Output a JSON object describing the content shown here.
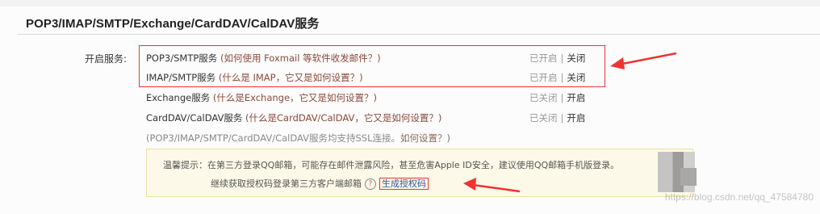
{
  "title": "POP3/IMAP/SMTP/Exchange/CardDAV/CalDAV服务",
  "label": "开启服务:",
  "rows": [
    {
      "service": "POP3/SMTP服务",
      "help": " (如何使用 Foxmail 等软件收发邮件？)",
      "state": "已开启",
      "sep": "|",
      "action": "关闭"
    },
    {
      "service": "IMAP/SMTP服务",
      "help": " (什么是 IMAP，它又是如何设置？)",
      "state": "已开启",
      "sep": "|",
      "action": "关闭"
    },
    {
      "service": "Exchange服务",
      "help": " (什么是Exchange，它又是如何设置？)",
      "state": "已关闭",
      "sep": "|",
      "action": "开启"
    },
    {
      "service": "CardDAV/CalDAV服务",
      "help": " (什么是CardDAV/CalDAV，它又是如何设置？)",
      "state": "已关闭",
      "sep": "|",
      "action": "开启"
    }
  ],
  "ssl_note": "(POP3/IMAP/SMTP/CardDAV/CalDAV服务均支持SSL连接。",
  "ssl_note_q": "如何设置？)",
  "tip": {
    "line1": "温馨提示：在第三方登录QQ邮箱，可能存在邮件泄露风险，甚至危害Apple ID安全，建议使用QQ邮箱手机版登录。",
    "line2": "继续获取授权码登录第三方客户端邮箱",
    "help_glyph": "?",
    "generate": "生成授权码"
  },
  "watermark": "https://blog.csdn.net/qq_47584780",
  "colors": {
    "annotation": "#e33333",
    "tip_bg": "#fdf9e8",
    "link": "#2a55a8"
  }
}
